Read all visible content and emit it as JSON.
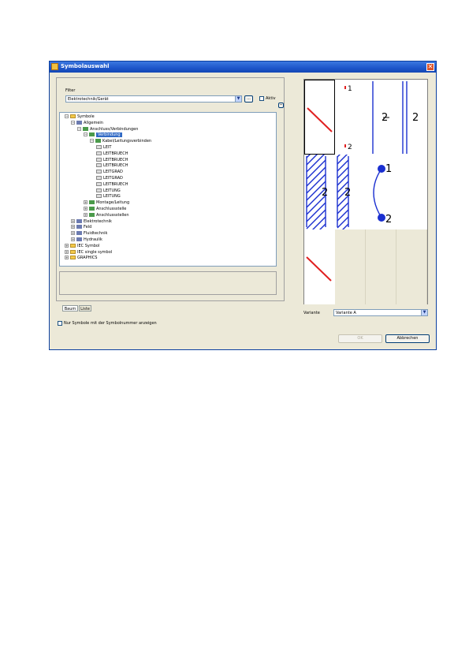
{
  "window": {
    "title": "Symbolauswahl",
    "close_glyph": "✕"
  },
  "filter": {
    "label": "Filter",
    "value": "Elektrotechnik/Gerät",
    "ellipsis": "...",
    "checkbox_label": "Aktiv"
  },
  "tree": {
    "items": [
      {
        "label": "Symbole",
        "expander": "−",
        "icon": "folder"
      },
      {
        "label": "Allgemein",
        "expander": "−",
        "icon": "lib"
      },
      {
        "label": "Anschluss/Verbindungen",
        "expander": "−",
        "icon": "sym"
      },
      {
        "label": "Verbindung",
        "expander": "−",
        "icon": "sym"
      },
      {
        "label": "Kabel/Leitungsverbinden",
        "expander": "−",
        "icon": "sym"
      },
      {
        "label": "LEIT",
        "expander": "",
        "icon": "page"
      },
      {
        "label": "LEITBRUECH",
        "expander": "",
        "icon": "page"
      },
      {
        "label": "LEITBRUECH",
        "expander": "",
        "icon": "page"
      },
      {
        "label": "LEITBRUECH",
        "expander": "",
        "icon": "page"
      },
      {
        "label": "LEITGRAD",
        "expander": "",
        "icon": "page"
      },
      {
        "label": "LEITGRAD",
        "expander": "",
        "icon": "page"
      },
      {
        "label": "LEITBRUECH",
        "expander": "",
        "icon": "page"
      },
      {
        "label": "LEITUNG",
        "expander": "",
        "icon": "page"
      },
      {
        "label": "LEITUNG",
        "expander": "",
        "icon": "page"
      },
      {
        "label": "Montage/Leitung",
        "expander": "+",
        "icon": "sym"
      },
      {
        "label": "Anschlussstelle",
        "expander": "+",
        "icon": "sym"
      },
      {
        "label": "Anschlussstellen",
        "expander": "+",
        "icon": "sym"
      },
      {
        "label": "Elektrotechnik",
        "expander": "+",
        "icon": "lib"
      },
      {
        "label": "Feld",
        "expander": "+",
        "icon": "lib"
      },
      {
        "label": "Fluidtechnik",
        "expander": "+",
        "icon": "lib"
      },
      {
        "label": "Hydraulik",
        "expander": "+",
        "icon": "lib"
      },
      {
        "label": "IEC Symbol",
        "expander": "+",
        "icon": "folder"
      },
      {
        "label": "IEC single symbol",
        "expander": "+",
        "icon": "folder"
      },
      {
        "label": "GRAPHICS",
        "expander": "+",
        "icon": "folder"
      }
    ]
  },
  "tabs": {
    "tree_label": "Baum",
    "list_label": "Liste"
  },
  "options": {
    "checkbox_label": "Nur Symbole mit der Symbolnummer anzeigen"
  },
  "preview": {
    "cells": [
      {
        "kind": "slash",
        "label": "",
        "label2": ""
      },
      {
        "kind": "nums",
        "label": "1",
        "label2": "2"
      },
      {
        "kind": "vline",
        "label": "2",
        "label2": ""
      },
      {
        "kind": "dvline",
        "label": "2",
        "label2": ""
      },
      {
        "kind": "hatchwide",
        "label": "2",
        "label2": ""
      },
      {
        "kind": "hatchnarrow",
        "label": "2",
        "label2": ""
      },
      {
        "kind": "arc",
        "label": "1",
        "label2": "2"
      },
      {
        "kind": "blank",
        "label": "",
        "label2": ""
      },
      {
        "kind": "slash",
        "label": "",
        "label2": ""
      },
      {
        "kind": "empty",
        "label": "",
        "label2": ""
      },
      {
        "kind": "empty",
        "label": "",
        "label2": ""
      },
      {
        "kind": "empty",
        "label": "",
        "label2": ""
      }
    ],
    "variant_label": "Variante",
    "variant_value": "Variante A"
  },
  "buttons": {
    "ok": "OK",
    "cancel": "Abbrechen"
  },
  "colors": {
    "symbol_red": "#e02020",
    "symbol_blue": "#1a2fd0",
    "selection": "#316ac5"
  }
}
